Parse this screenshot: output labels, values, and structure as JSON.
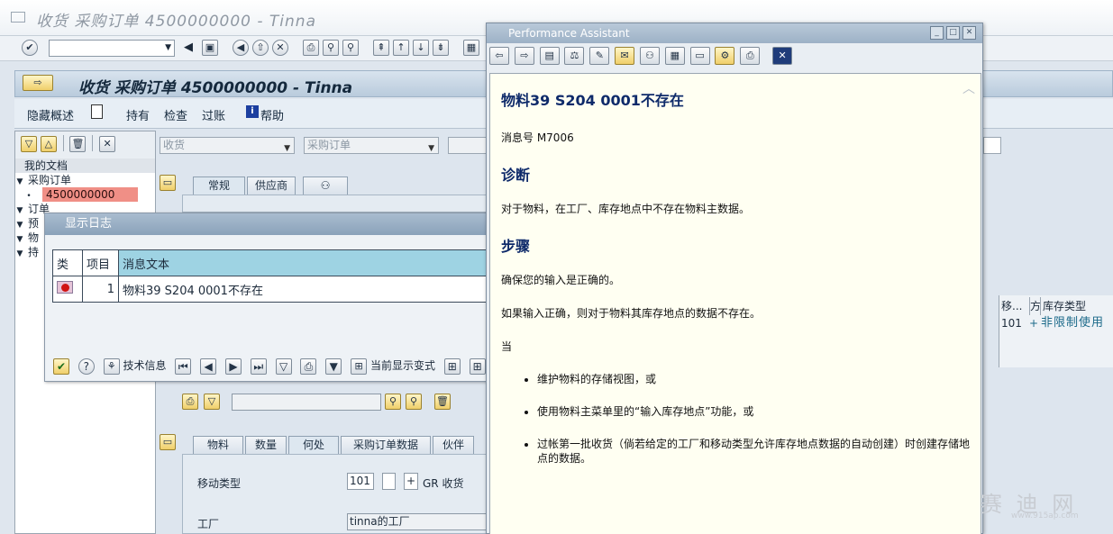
{
  "window": {
    "title": "收货 采购订单 4500000000 - Tinna"
  },
  "app": {
    "title": "收货 采购订单 4500000000 - Tinna",
    "toolbar": {
      "hide_overview": "隐藏概述",
      "hold": "持有",
      "check": "检查",
      "post": "过账",
      "help": "帮助"
    }
  },
  "tree": {
    "header": "我的文档",
    "items": [
      {
        "label": "采购订单",
        "indent": 0,
        "open": true
      },
      {
        "label": "4500000000",
        "indent": 1,
        "selected": true
      },
      {
        "label": "订单",
        "indent": 0,
        "open": true
      },
      {
        "label": "预",
        "indent": 0,
        "open": true
      },
      {
        "label": "物",
        "indent": 0,
        "open": true
      },
      {
        "label": "持",
        "indent": 0,
        "open": true
      }
    ]
  },
  "main": {
    "action_combo": "收货",
    "ref_combo": "采购订单",
    "header_tabs": [
      "常规",
      "供应商",
      "��"
    ],
    "item_tabs": [
      "物料",
      "数量",
      "何处",
      "采购订单数据",
      "伙伴"
    ],
    "movement_type_label": "移动类型",
    "movement_type_value": "101",
    "movement_sign": "+",
    "movement_text": "GR 收货",
    "plant_label": "工厂",
    "plant_value": "tinna的工厂"
  },
  "right_grid": {
    "headers": [
      "移...",
      "方",
      "库存类型"
    ],
    "row": [
      "101",
      "+",
      "非限制使用"
    ]
  },
  "log": {
    "title": "显示日志",
    "columns": [
      "类",
      "项目",
      "消息文本"
    ],
    "rows": [
      {
        "item": "1",
        "text": "物料39 S204 0001不存在"
      }
    ],
    "buttons": {
      "tech_info": "技术信息",
      "current_variant": "当前显示变式",
      "print": "打印"
    }
  },
  "pa": {
    "title": "Performance Assistant",
    "heading": "物料39 S204 0001不存在",
    "msg_no": "消息号  M7006",
    "diag_title": "诊断",
    "diag_text": "对于物料，在工厂、库存地点中不存在物料主数据。",
    "steps_title": "步骤",
    "step1": "确保您的输入是正确的。",
    "step2": "如果输入正确，则对于物料其库存地点的数据不存在。",
    "when": "当",
    "bullets": [
      "维护物料的存储视图，或",
      "使用物料主菜单里的“输入库存地点”功能，或",
      "过帐第一批收货（倘若给定的工厂和移动类型允许库存地点数据的自动创建）时创建存储地点的数据。"
    ]
  },
  "watermark": {
    "text": "赛 迪 网",
    "url": "www.915ap.com"
  }
}
